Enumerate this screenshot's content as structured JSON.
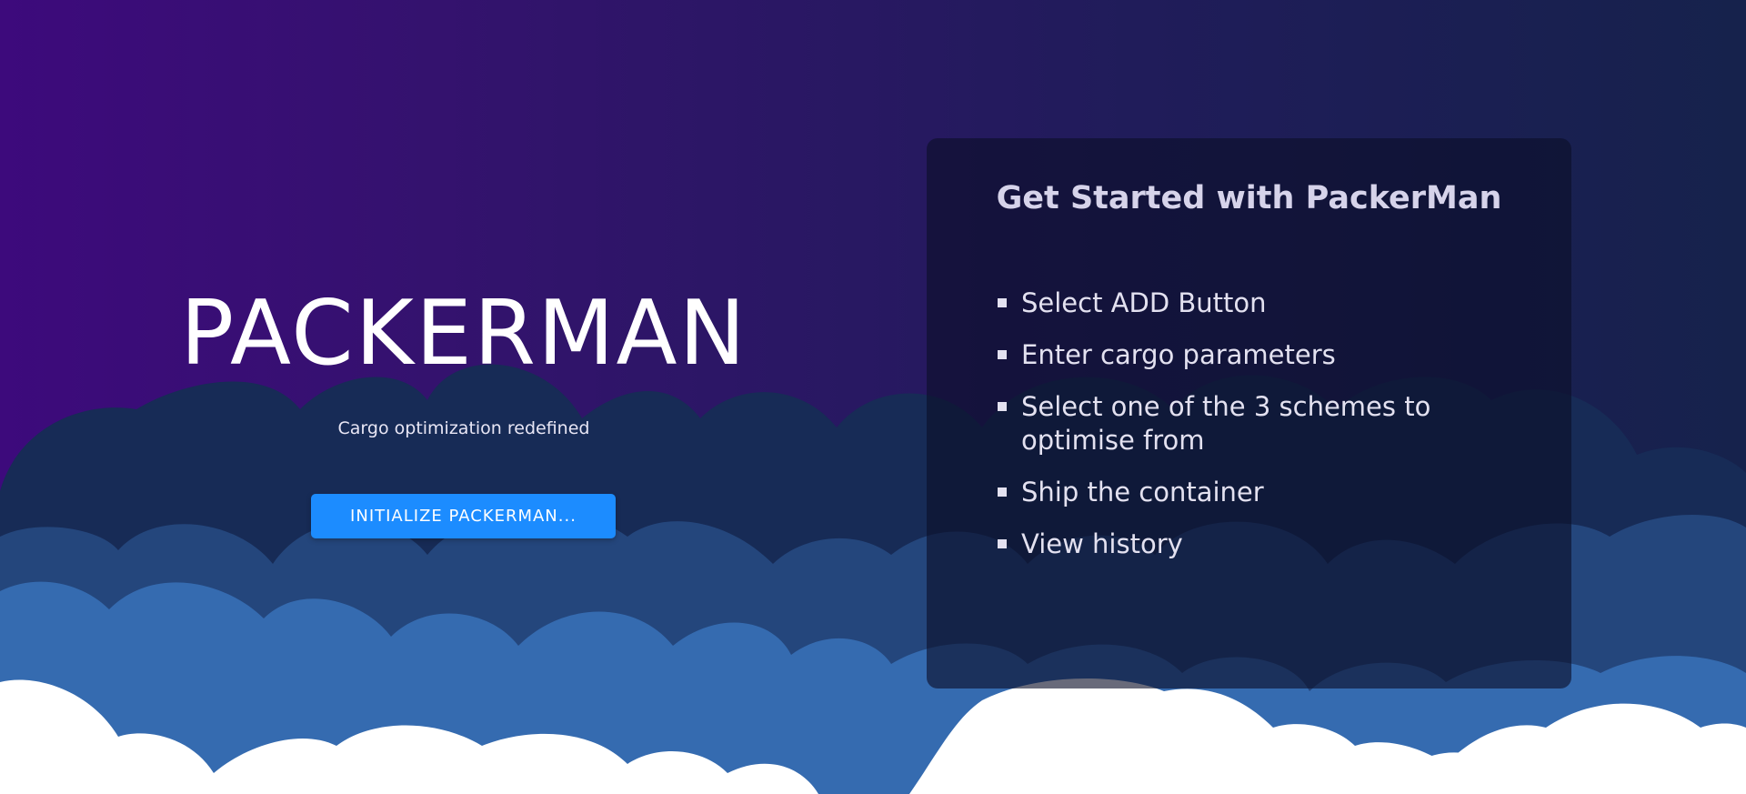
{
  "hero": {
    "title": "PACKERMAN",
    "subtitle": "Cargo optimization redefined",
    "button_label": "INITIALIZE PACKERMAN..."
  },
  "panel": {
    "title": "Get Started with PackerMan",
    "steps": [
      "Select ADD Button",
      "Enter cargo parameters",
      "Select one of the 3 schemes to optimise from",
      "Ship the container",
      "View history"
    ]
  },
  "colors": {
    "background_left": "#3d0a7c",
    "background_right": "#16224c",
    "cloud_dark": "#172b56",
    "cloud_mid": "#24467c",
    "cloud_light": "#356bb0",
    "cloud_white": "#ffffff",
    "button": "#1c8cff"
  }
}
